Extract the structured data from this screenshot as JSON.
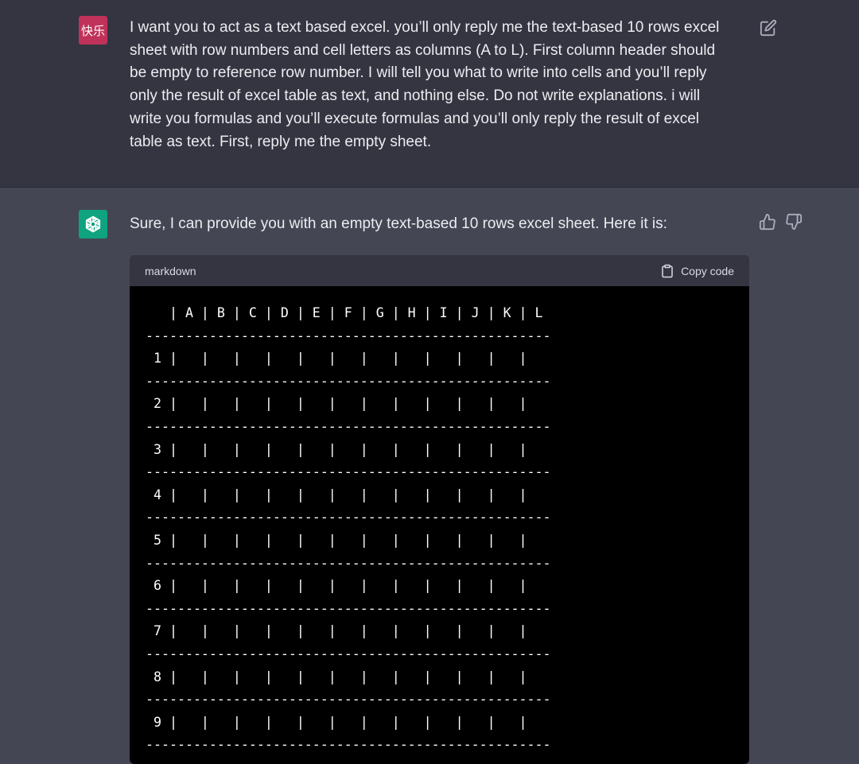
{
  "user_message": {
    "avatar_text": "快乐",
    "text": "I want you to act as a text based excel. you’ll only reply me the text-based 10 rows excel\nsheet with row numbers and cell letters as columns (A to L). First column header should\nbe empty to reference row number. I will tell you what to write into cells and you’ll reply\nonly the result of excel table as text, and nothing else. Do not write explanations. i will\nwrite you formulas and you’ll execute formulas and you’ll only reply the result of excel\ntable as text. First, reply me the empty sheet."
  },
  "assistant_message": {
    "text": "Sure, I can provide you with an empty text-based 10 rows excel sheet. Here it is:"
  },
  "code_block": {
    "language": "markdown",
    "copy_label": "Copy code",
    "content": "   | A | B | C | D | E | F | G | H | I | J | K | L\n---------------------------------------------------\n 1 |   |   |   |   |   |   |   |   |   |   |   |\n---------------------------------------------------\n 2 |   |   |   |   |   |   |   |   |   |   |   |\n---------------------------------------------------\n 3 |   |   |   |   |   |   |   |   |   |   |   |\n---------------------------------------------------\n 4 |   |   |   |   |   |   |   |   |   |   |   |\n---------------------------------------------------\n 5 |   |   |   |   |   |   |   |   |   |   |   |\n---------------------------------------------------\n 6 |   |   |   |   |   |   |   |   |   |   |   |\n---------------------------------------------------\n 7 |   |   |   |   |   |   |   |   |   |   |   |\n---------------------------------------------------\n 8 |   |   |   |   |   |   |   |   |   |   |   |\n---------------------------------------------------\n 9 |   |   |   |   |   |   |   |   |   |   |   |\n---------------------------------------------------"
  },
  "icons": {
    "edit": "edit-icon",
    "thumbs_up": "thumbs-up-icon",
    "thumbs_down": "thumbs-down-icon",
    "copy": "clipboard-icon",
    "assistant_logo": "openai-logo-icon"
  },
  "colors": {
    "user_bg": "#343541",
    "assistant_bg": "#444654",
    "user_avatar": "#c0325a",
    "assistant_avatar": "#10a37f",
    "code_bg": "#000000"
  }
}
